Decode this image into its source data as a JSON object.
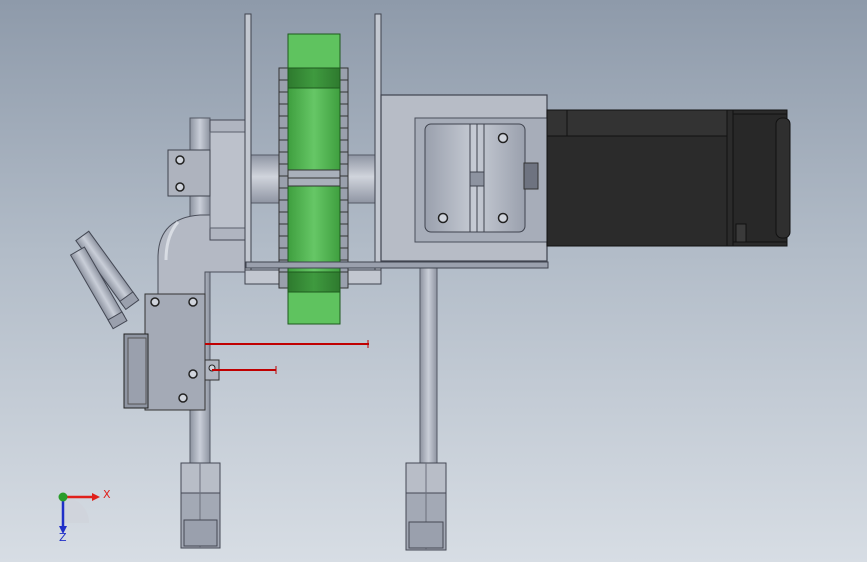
{
  "viewport": {
    "colors": {
      "background_top": "#8e9aaa",
      "background_bottom": "#d7dde4",
      "steel": "#aab0bd",
      "steel_dark": "#7d8391",
      "motor": "#2b2b2b",
      "green_wheel": "#5fc35f",
      "red_line": "#c00000",
      "axis_x": "#e0201a",
      "axis_y": "#2a9d2a",
      "axis_z": "#1f2fc8"
    }
  },
  "triad": {
    "x_label": "X",
    "z_label": "Z"
  }
}
